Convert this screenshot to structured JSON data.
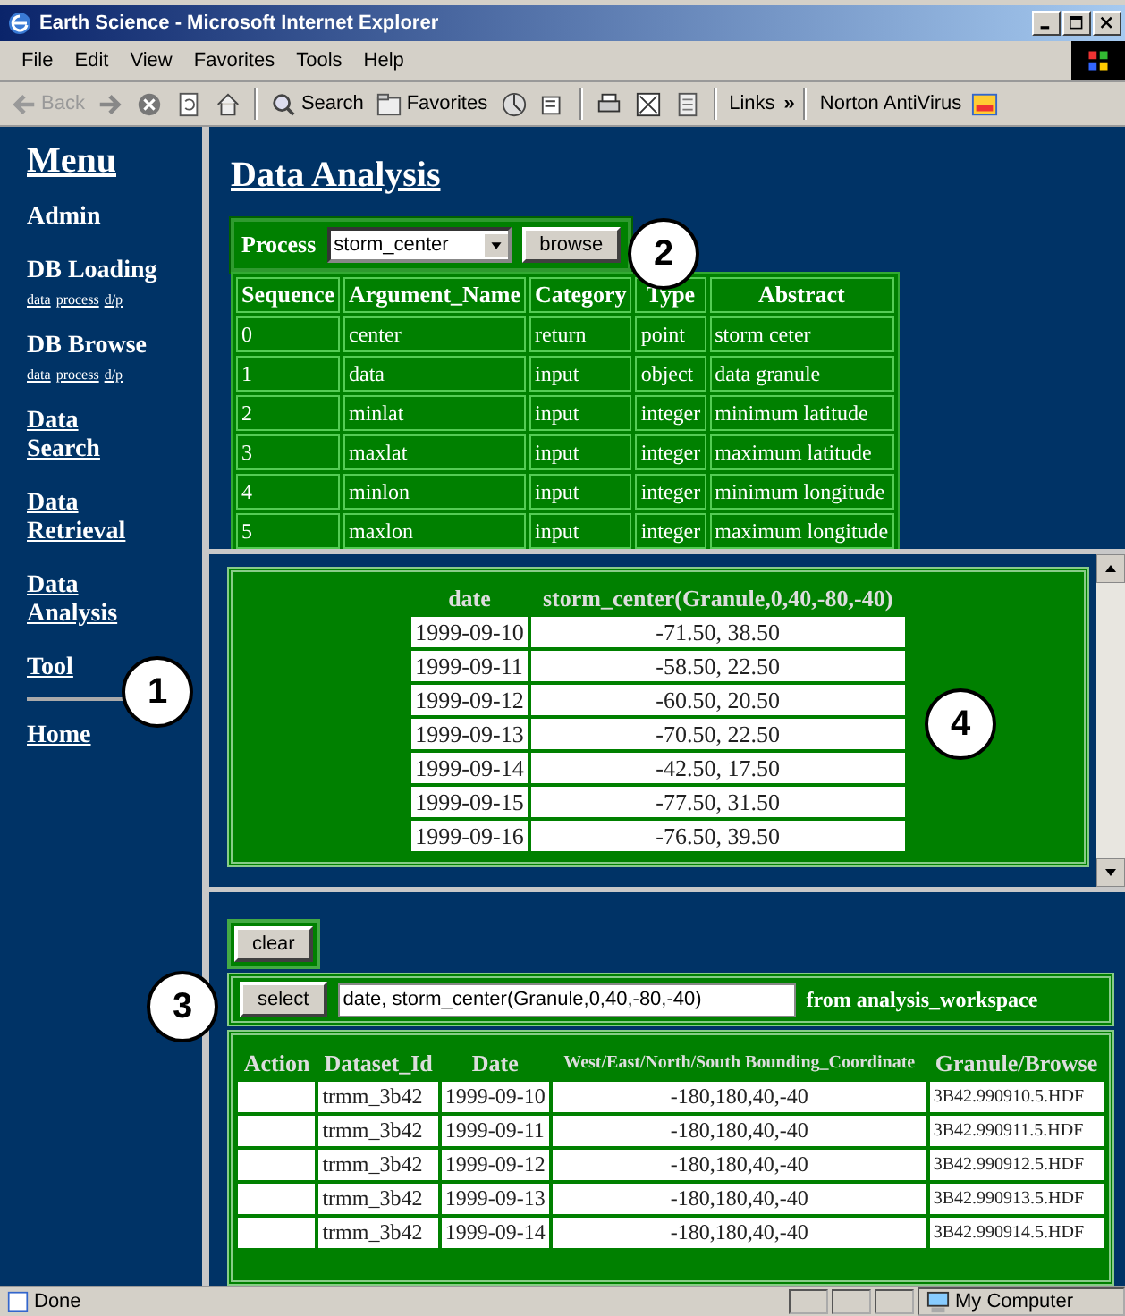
{
  "window": {
    "title": "Earth Science - Microsoft Internet Explorer"
  },
  "menu_bar": [
    "File",
    "Edit",
    "View",
    "Favorites",
    "Tools",
    "Help"
  ],
  "toolbar": [
    {
      "kind": "back",
      "label": "Back",
      "disabled": true
    },
    {
      "kind": "forward"
    },
    {
      "kind": "stop"
    },
    {
      "kind": "refresh"
    },
    {
      "kind": "home"
    },
    {
      "kind": "search",
      "label": "Search"
    },
    {
      "kind": "favorites",
      "label": "Favorites"
    },
    {
      "kind": "media"
    },
    {
      "kind": "mail"
    },
    {
      "kind": "print"
    },
    {
      "kind": "edit"
    },
    {
      "kind": "discuss"
    }
  ],
  "links_bar": {
    "label": "Links",
    "chevron": "»",
    "item": "Norton AntiVirus"
  },
  "sidebar": {
    "title": "Menu",
    "items": [
      {
        "label": "Admin"
      },
      {
        "label": "DB Loading",
        "sublinks": [
          "data",
          "process",
          "d/p"
        ]
      },
      {
        "label": "DB Browse",
        "sublinks": [
          "data",
          "process",
          "d/p"
        ]
      },
      {
        "label": "Data Search"
      },
      {
        "label": "Data Retrieval"
      },
      {
        "label": "Data Analysis"
      },
      {
        "label": "Tool",
        "separator_below": true
      },
      {
        "label": "Home"
      }
    ]
  },
  "heading": "Data Analysis",
  "process_form": {
    "label": "Process",
    "value": "storm_center",
    "button": "browse"
  },
  "arguments_table": {
    "columns": [
      "Sequence",
      "Argument_Name",
      "Category",
      "Type",
      "Abstract"
    ],
    "rows": [
      [
        "0",
        "center",
        "return",
        "point",
        "storm ceter"
      ],
      [
        "1",
        "data",
        "input",
        "object",
        "data granule"
      ],
      [
        "2",
        "minlat",
        "input",
        "integer",
        "minimum latitude"
      ],
      [
        "3",
        "maxlat",
        "input",
        "integer",
        "maximum latitude"
      ],
      [
        "4",
        "minlon",
        "input",
        "integer",
        "minimum longitude"
      ],
      [
        "5",
        "maxlon",
        "input",
        "integer",
        "maximum longitude"
      ]
    ]
  },
  "results_table": {
    "columns": [
      "date",
      "storm_center(Granule,0,40,-80,-40)"
    ],
    "rows": [
      [
        "1999-09-10",
        "-71.50, 38.50"
      ],
      [
        "1999-09-11",
        "-58.50, 22.50"
      ],
      [
        "1999-09-12",
        "-60.50, 20.50"
      ],
      [
        "1999-09-13",
        "-70.50, 22.50"
      ],
      [
        "1999-09-14",
        "-42.50, 17.50"
      ],
      [
        "1999-09-15",
        "-77.50, 31.50"
      ],
      [
        "1999-09-16",
        "-76.50, 39.50"
      ]
    ]
  },
  "query": {
    "clear_button": "clear",
    "select_button": "select",
    "value": "date, storm_center(Granule,0,40,-80,-40)",
    "suffix": "from analysis_workspace"
  },
  "granules_table": {
    "columns": [
      "Action",
      "Dataset_Id",
      "Date",
      "West/East/North/South Bounding_Coordinate",
      "Granule/Browse"
    ],
    "rows": [
      [
        "",
        "trmm_3b42",
        "1999-09-10",
        "-180,180,40,-40",
        "3B42.990910.5.HDF"
      ],
      [
        "",
        "trmm_3b42",
        "1999-09-11",
        "-180,180,40,-40",
        "3B42.990911.5.HDF"
      ],
      [
        "",
        "trmm_3b42",
        "1999-09-12",
        "-180,180,40,-40",
        "3B42.990912.5.HDF"
      ],
      [
        "",
        "trmm_3b42",
        "1999-09-13",
        "-180,180,40,-40",
        "3B42.990913.5.HDF"
      ],
      [
        "",
        "trmm_3b42",
        "1999-09-14",
        "-180,180,40,-40",
        "3B42.990914.5.HDF"
      ]
    ]
  },
  "callouts": [
    "1",
    "2",
    "3",
    "4"
  ],
  "status_bar": {
    "text": "Done",
    "zone": "My Computer"
  }
}
